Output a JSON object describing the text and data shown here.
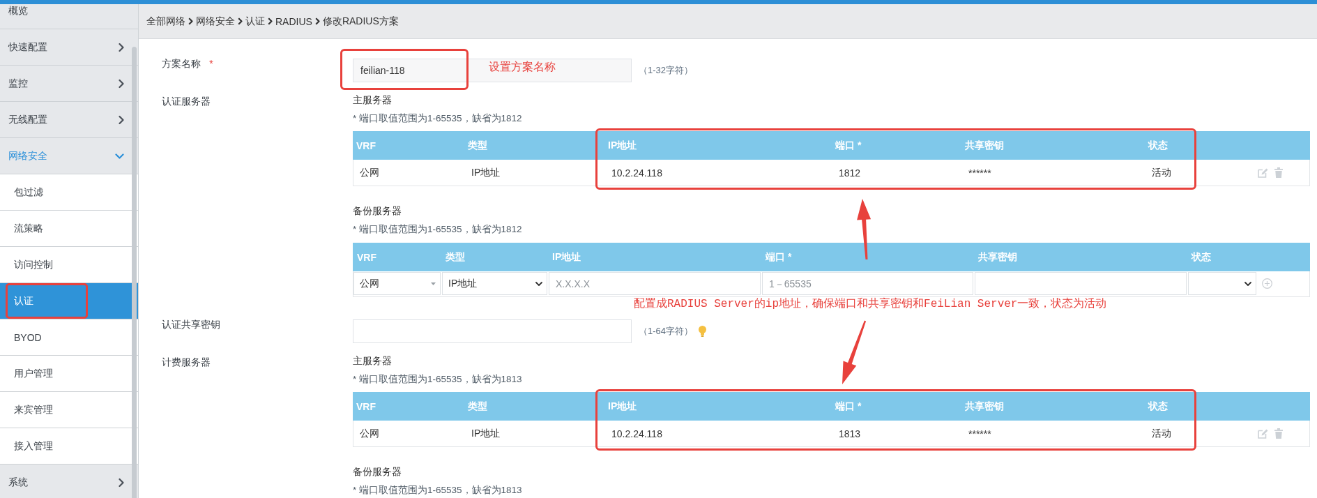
{
  "sidebar": {
    "items": [
      {
        "label": "概览",
        "kind": "page",
        "selected": false
      },
      {
        "label": "快速配置",
        "kind": "group",
        "selected": false,
        "expanded": false
      },
      {
        "label": "监控",
        "kind": "group",
        "selected": false,
        "expanded": false
      },
      {
        "label": "无线配置",
        "kind": "group",
        "selected": false,
        "expanded": false
      },
      {
        "label": "网络安全",
        "kind": "group",
        "selected": false,
        "expanded": true,
        "children": [
          {
            "label": "包过滤",
            "selected": false,
            "highlighted": false
          },
          {
            "label": "流策略",
            "selected": false,
            "highlighted": false
          },
          {
            "label": "访问控制",
            "selected": false,
            "highlighted": false
          },
          {
            "label": "认证",
            "selected": true,
            "highlighted": true
          },
          {
            "label": "BYOD",
            "selected": false,
            "highlighted": false
          },
          {
            "label": "用户管理",
            "selected": false,
            "highlighted": false
          },
          {
            "label": "来宾管理",
            "selected": false,
            "highlighted": false
          },
          {
            "label": "接入管理",
            "selected": false,
            "highlighted": false
          }
        ]
      },
      {
        "label": "系统",
        "kind": "group",
        "selected": false,
        "expanded": false
      }
    ]
  },
  "breadcrumb": [
    "全部网络",
    "网络安全",
    "认证",
    "RADIUS",
    "修改RADIUS方案"
  ],
  "form": {
    "rows": [
      {
        "kind": "input",
        "label": "方案名称",
        "required_mark": "*",
        "value": "feilian-118",
        "hint": "（1-32字符）",
        "highlighted": true,
        "note": "设置方案名称"
      },
      {
        "kind": "servers",
        "label": "认证服务器",
        "groups": [
          {
            "title": "主服务器",
            "note": "* 端口取值范围为1-65535，缺省为1812",
            "table": {
              "kind": "list",
              "highlighted": true,
              "columns": [
                "VRF",
                "类型",
                "IP地址",
                "端口 *",
                "共享密钥",
                "状态"
              ],
              "rows": [
                [
                  "公网",
                  "IP地址",
                  "10.2.24.118",
                  "1812",
                  "******",
                  "活动"
                ]
              ]
            }
          },
          {
            "title": "备份服务器",
            "note": "* 端口取值范围为1-65535，缺省为1812",
            "table": {
              "kind": "edit",
              "columns": [
                "VRF",
                "类型",
                "IP地址",
                "端口 *",
                "共享密钥",
                "状态"
              ],
              "fields": [
                {
                  "kind": "dropdown",
                  "value": "公网"
                },
                {
                  "kind": "select",
                  "value": "IP地址"
                },
                {
                  "kind": "input",
                  "placeholder": "X.X.X.X"
                },
                {
                  "kind": "input",
                  "placeholder": "1－65535"
                },
                {
                  "kind": "input"
                },
                {
                  "kind": "select"
                }
              ],
              "annotation": "配置成RADIUS Server的ip地址，确保端口和共享密钥和FeiLian Server一致，状态为活动"
            }
          }
        ]
      },
      {
        "kind": "input",
        "label": "认证共享密钥",
        "hint": "（1-64字符）",
        "tip": true
      },
      {
        "kind": "servers",
        "label": "计费服务器",
        "groups": [
          {
            "title": "主服务器",
            "note": "* 端口取值范围为1-65535，缺省为1813",
            "table": {
              "kind": "list",
              "highlighted": true,
              "columns": [
                "VRF",
                "类型",
                "IP地址",
                "端口 *",
                "共享密钥",
                "状态"
              ],
              "rows": [
                [
                  "公网",
                  "IP地址",
                  "10.2.24.118",
                  "1813",
                  "******",
                  "活动"
                ]
              ]
            }
          },
          {
            "title": "备份服务器",
            "note": "* 端口取值范围为1-65535，缺省为1813"
          }
        ]
      }
    ]
  }
}
